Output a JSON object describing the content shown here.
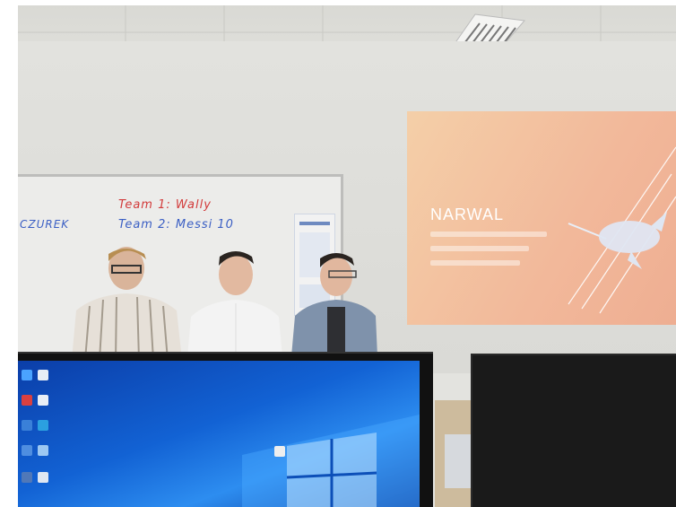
{
  "scene": {
    "whiteboard": {
      "team1": "Team 1: Wally",
      "team2": "Team 2: Messi 10",
      "left_text": "CZUREK"
    },
    "slide": {
      "title": "NARWAL",
      "subtitle_lines": [
        "",
        "",
        ""
      ]
    }
  },
  "colors": {
    "slide_bg": "#f2b89a",
    "desktop_blue": "#1262d4"
  },
  "icons": [
    "ceiling-light-icon",
    "narwhal-icon",
    "windows-logo-icon",
    "desktop-icon"
  ]
}
